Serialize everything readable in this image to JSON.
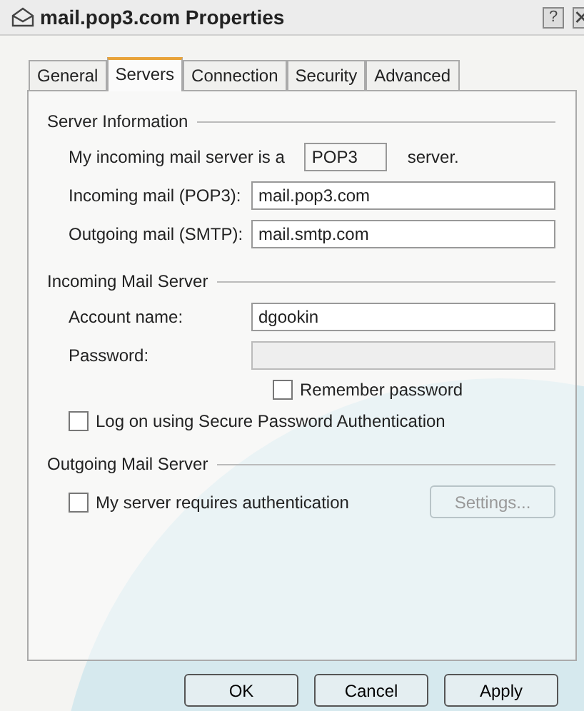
{
  "window": {
    "title": "mail.pop3.com Properties",
    "help_button": "?"
  },
  "tabs": [
    {
      "label": "General",
      "selected": false
    },
    {
      "label": "Servers",
      "selected": true
    },
    {
      "label": "Connection",
      "selected": false
    },
    {
      "label": "Security",
      "selected": false
    },
    {
      "label": "Advanced",
      "selected": false
    }
  ],
  "server_information": {
    "heading": "Server Information",
    "server_type_label": "My incoming mail server is a",
    "server_type": "POP3",
    "server_type_suffix": "server.",
    "fields": [
      {
        "label": "Incoming mail (POP3):",
        "value": "mail.pop3.com",
        "disabled": false
      },
      {
        "label": "Outgoing mail (SMTP):",
        "value": "mail.smtp.com",
        "disabled": false
      }
    ]
  },
  "incoming_mail_server": {
    "heading": "Incoming Mail Server",
    "fields": [
      {
        "label": "Account name:",
        "value": "dgookin",
        "disabled": false
      },
      {
        "label": "Password:",
        "disabled": true
      }
    ],
    "remember_password": {
      "label": "Remember password",
      "checked": false
    },
    "secure_auth": {
      "label": "Log on using Secure Password Authentication",
      "checked": false
    }
  },
  "outgoing_mail_server": {
    "heading": "Outgoing Mail Server",
    "requires_auth": {
      "label": "My server requires authentication",
      "checked": false
    },
    "settings_button": {
      "label": "Settings...",
      "disabled": true
    }
  },
  "buttons": [
    {
      "label": "OK"
    },
    {
      "label": "Cancel"
    },
    {
      "label": "Apply"
    }
  ]
}
